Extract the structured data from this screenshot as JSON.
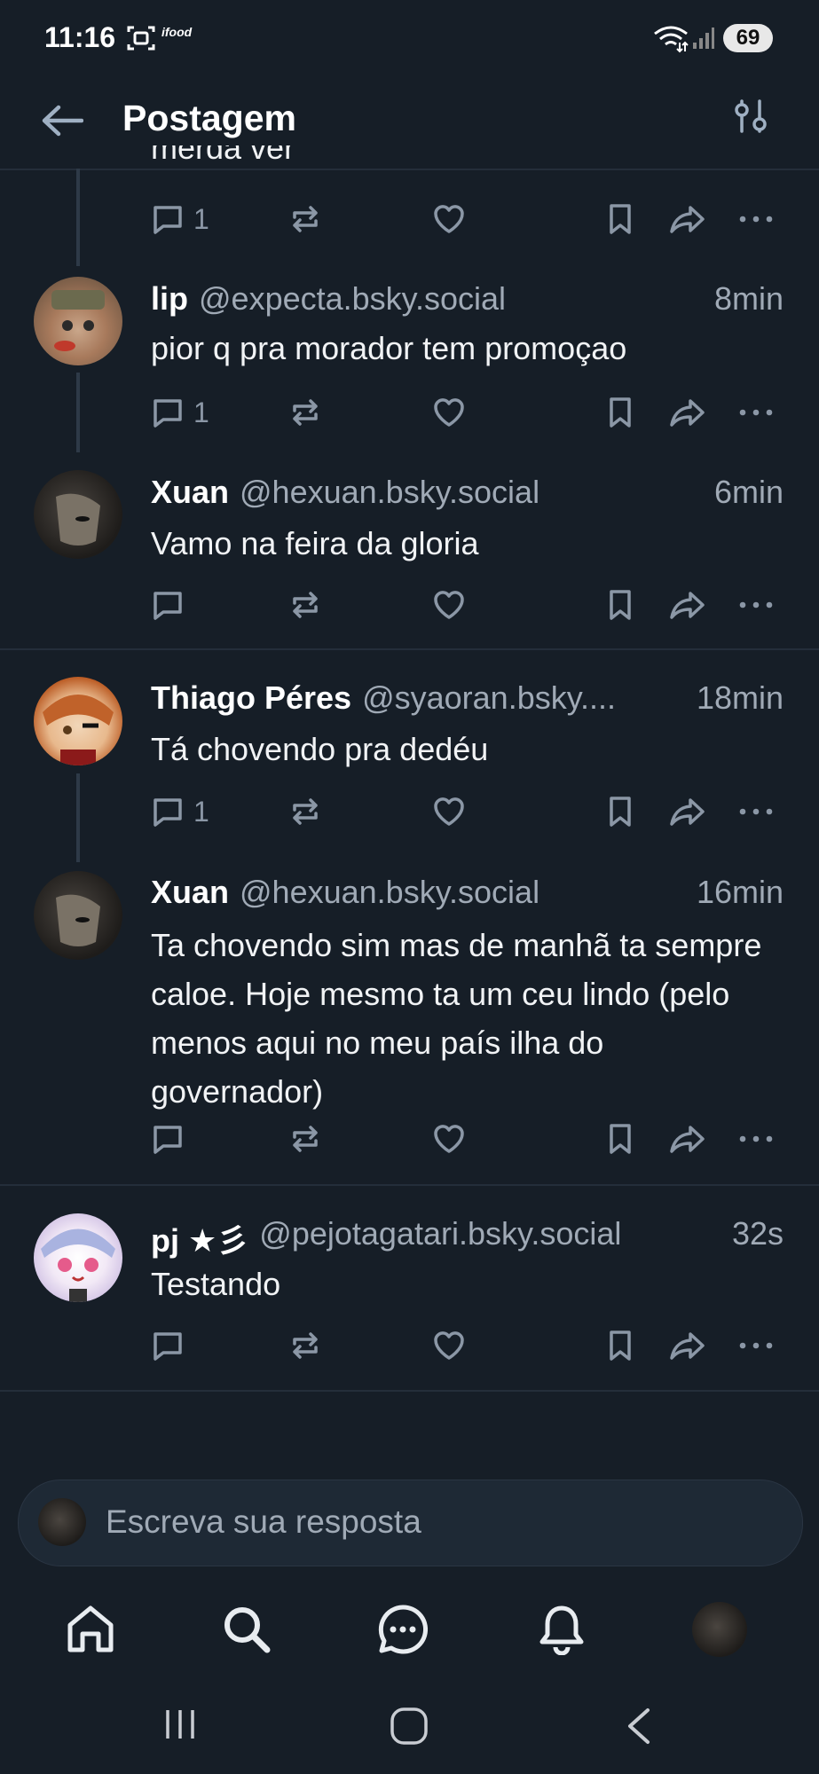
{
  "status_bar": {
    "time": "11:16",
    "battery": "69",
    "ifood_label": "ifood"
  },
  "header": {
    "title": "Postagem"
  },
  "partial_post": {
    "text_fragment": "merda ver",
    "reply_count": "1"
  },
  "posts": [
    {
      "name": "lip",
      "handle": "@expecta.bsky.social",
      "time": "8min",
      "text": "pior q pra morador tem promoçao",
      "reply_count": "1"
    },
    {
      "name": "Xuan",
      "handle": "@hexuan.bsky.social",
      "time": "6min",
      "text": "Vamo na feira da gloria",
      "reply_count": ""
    },
    {
      "name": "Thiago Péres",
      "handle": "@syaoran.bsky....",
      "time": "18min",
      "text": "Tá chovendo pra dedéu",
      "reply_count": "1"
    },
    {
      "name": "Xuan",
      "handle": "@hexuan.bsky.social",
      "time": "16min",
      "text": "Ta chovendo sim mas de manhã ta sempre caloe. Hoje mesmo ta um ceu lindo (pelo menos aqui no meu país ilha do governador)",
      "reply_count": ""
    },
    {
      "name": "pj ★彡",
      "handle": "@pejotagatari.bsky.social",
      "time": "32s",
      "text": "Testando",
      "reply_count": ""
    }
  ],
  "reply_box": {
    "placeholder": "Escreva sua resposta"
  },
  "colors": {
    "background": "#161e27",
    "text": "#f1f3f5",
    "muted": "#a0aab6",
    "icon": "#8b97a6",
    "accent": "#208bfe"
  }
}
